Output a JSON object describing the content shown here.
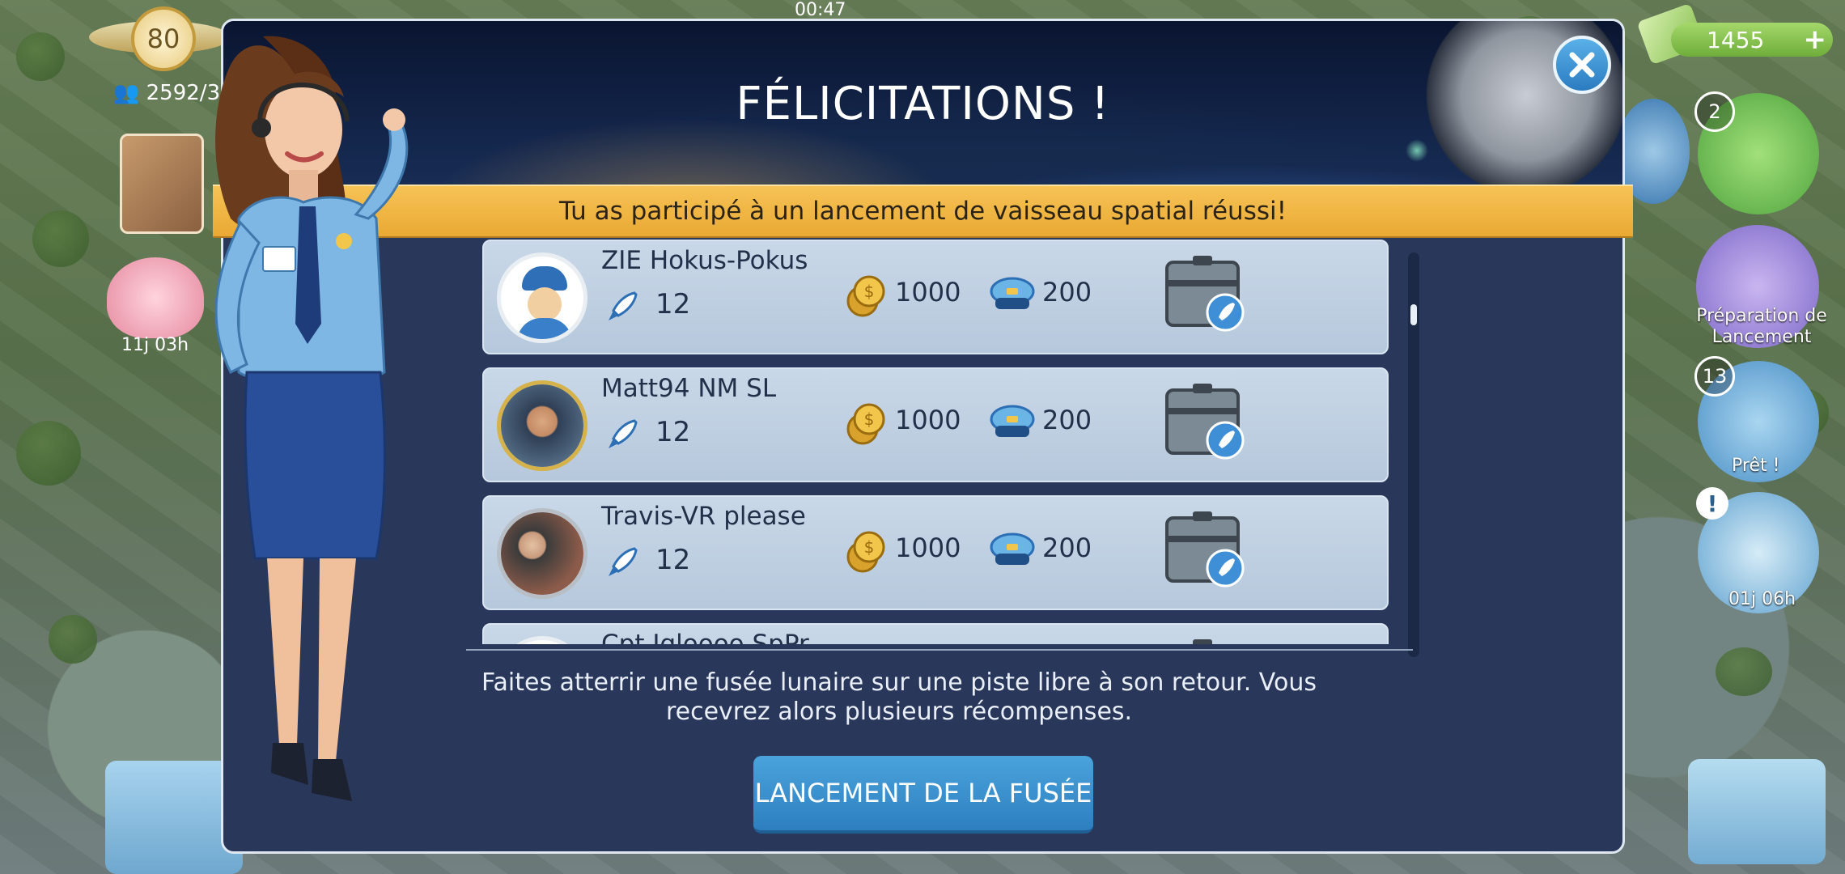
{
  "status_bar": {
    "time": "00:47"
  },
  "hud_left": {
    "level": "80",
    "population": "2592/3",
    "timer": "11j 03h"
  },
  "hud_right": {
    "money": "1455",
    "money_plus": "+",
    "tower_badge": "2",
    "preparation_label": "Préparation de Lancement",
    "radar_badge": "13",
    "ready_label": "Prêt !",
    "alert_mark": "!",
    "gauge_timer": "01j 06h"
  },
  "modal": {
    "title": "FÉLICITATIONS !",
    "banner": "Tu as participé à un lancement de vaisseau spatial réussi!",
    "rows": [
      {
        "name": "ZIE Hokus-Pokus",
        "launches": "12",
        "coins": "1000",
        "caps": "200",
        "avatar": "pilot"
      },
      {
        "name": "Matt94 NM SL",
        "launches": "12",
        "coins": "1000",
        "caps": "200",
        "avatar": "photo"
      },
      {
        "name": "Travis-VR please",
        "launches": "12",
        "coins": "1000",
        "caps": "200",
        "avatar": "photo"
      },
      {
        "name": "Cpt Igloooo SpPr",
        "launches": "",
        "coins": "",
        "caps": "",
        "avatar": "pilot"
      }
    ],
    "info_text": "Faites atterrir une fusée lunaire sur une piste libre à son retour. Vous recevrez alors plusieurs récompenses.",
    "launch_button": "LANCEMENT DE LA FUSÉE"
  },
  "colors": {
    "modal_bg": "#28375a",
    "banner": "#f2b845",
    "row_bg": "#c0d1e3",
    "button": "#3a92d0"
  }
}
